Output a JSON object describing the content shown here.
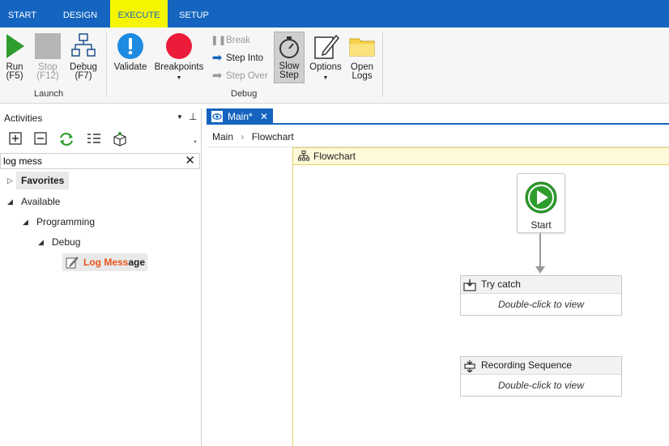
{
  "tabs": [
    {
      "label": "START"
    },
    {
      "label": "DESIGN"
    },
    {
      "label": "EXECUTE"
    },
    {
      "label": "SETUP"
    }
  ],
  "ribbon": {
    "run": {
      "label": "Run",
      "shortcut": "(F5)"
    },
    "stop": {
      "label": "Stop",
      "shortcut": "(F12)"
    },
    "debug": {
      "label": "Debug",
      "shortcut": "(F7)"
    },
    "launch_group": "Launch",
    "validate": "Validate",
    "breakpoints": "Breakpoints",
    "break": "Break",
    "step_into": "Step Into",
    "step_over": "Step Over",
    "slow_step": {
      "line1": "Slow",
      "line2": "Step"
    },
    "options": "Options",
    "open_logs": {
      "line1": "Open",
      "line2": "Logs"
    },
    "debug_group": "Debug"
  },
  "activities": {
    "title": "Activities",
    "search_value": "log mess",
    "tree": {
      "favorites": "Favorites",
      "available": "Available",
      "programming": "Programming",
      "debug": "Debug",
      "log_message_match": "Log Mess",
      "log_message_rest": "age"
    }
  },
  "designer": {
    "doc_tab": "Main*",
    "breadcrumb": [
      "Main",
      "Flowchart"
    ],
    "flowchart_title": "Flowchart",
    "start_label": "Start",
    "activities": [
      {
        "title": "Try catch",
        "hint": "Double-click to view"
      },
      {
        "title": "Recording Sequence",
        "hint": "Double-click to view"
      }
    ]
  },
  "colors": {
    "tab_bar": "#1565c0",
    "active_tab_highlight": "#f5f500",
    "search_highlight": "#e8531b",
    "flowchart_header": "#fef9d8"
  }
}
